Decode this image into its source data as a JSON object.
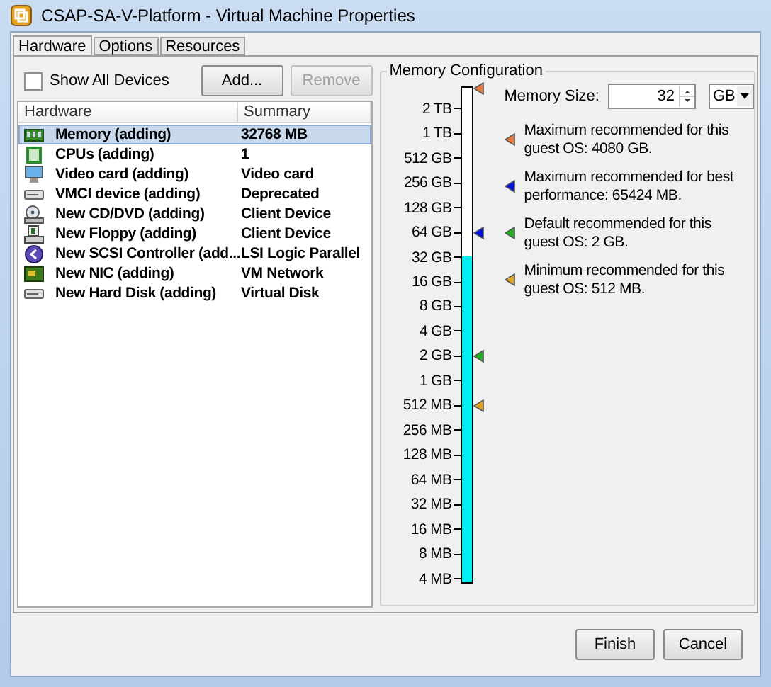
{
  "window": {
    "title": "CSAP-SA-V-Platform - Virtual Machine Properties"
  },
  "tabs": [
    {
      "label": "Hardware",
      "selected": true
    },
    {
      "label": "Options",
      "selected": false
    },
    {
      "label": "Resources",
      "selected": false
    }
  ],
  "hardware_panel": {
    "show_all_devices": {
      "label": "Show All Devices",
      "checked": false
    },
    "buttons": [
      {
        "label": "Add...",
        "disabled": false
      },
      {
        "label": "Remove",
        "disabled": true
      }
    ],
    "columns": [
      "Hardware",
      "Summary"
    ],
    "rows": [
      {
        "kind": "memory",
        "name": "Memory (adding)",
        "summary": "32768 MB",
        "selected": true
      },
      {
        "kind": "cpu",
        "name": "CPUs (adding)",
        "summary": "1",
        "selected": false
      },
      {
        "kind": "video",
        "name": "Video card  (adding)",
        "summary": "Video card",
        "selected": false
      },
      {
        "kind": "device",
        "name": "VMCI device (adding)",
        "summary": "Deprecated",
        "selected": false
      },
      {
        "kind": "cdrom",
        "name": "New CD/DVD (adding)",
        "summary": "Client Device",
        "selected": false
      },
      {
        "kind": "floppy",
        "name": "New Floppy (adding)",
        "summary": "Client Device",
        "selected": false
      },
      {
        "kind": "scsi",
        "name": "New SCSI Controller (add...",
        "summary": "LSI Logic Parallel",
        "selected": false
      },
      {
        "kind": "nic",
        "name": "New NIC (adding)",
        "summary": "VM Network",
        "selected": false
      },
      {
        "kind": "device",
        "name": "New Hard Disk (adding)",
        "summary": "Virtual Disk",
        "selected": false
      }
    ]
  },
  "memory_configuration": {
    "title": "Memory Configuration",
    "memory_size": {
      "label": "Memory Size:",
      "value": "32",
      "unit": "GB"
    },
    "scale": {
      "level": 0.66,
      "top_marker": {
        "color": "#e87a3c"
      },
      "ticks": [
        {
          "label": "2 TB"
        },
        {
          "label": "1 TB"
        },
        {
          "label": "512 GB"
        },
        {
          "label": "256 GB"
        },
        {
          "label": "128 GB"
        },
        {
          "label": "64 GB",
          "color": "#0010e0"
        },
        {
          "label": "32 GB"
        },
        {
          "label": "16 GB"
        },
        {
          "label": "8 GB"
        },
        {
          "label": "4 GB"
        },
        {
          "label": "2 GB",
          "color": "#20b020"
        },
        {
          "label": "1 GB"
        },
        {
          "label": "512 MB",
          "color": "#e0a020"
        },
        {
          "label": "256 MB"
        },
        {
          "label": "128 MB"
        },
        {
          "label": "64 MB"
        },
        {
          "label": "32 MB"
        },
        {
          "label": "16 MB"
        },
        {
          "label": "8 MB"
        },
        {
          "label": "4 MB"
        }
      ]
    },
    "legend": [
      {
        "text": "Maximum recommended for this guest OS: 4080 GB.",
        "color": "#e87a3c"
      },
      {
        "text": "Maximum recommended for best performance: 65424 MB.",
        "color": "#0010e0"
      },
      {
        "text": "Default recommended for this guest OS: 2 GB.",
        "color": "#20b020"
      },
      {
        "text": "Minimum recommended for this guest OS: 512 MB.",
        "color": "#e0a020"
      }
    ]
  },
  "footer_buttons": [
    "Finish",
    "Cancel"
  ]
}
